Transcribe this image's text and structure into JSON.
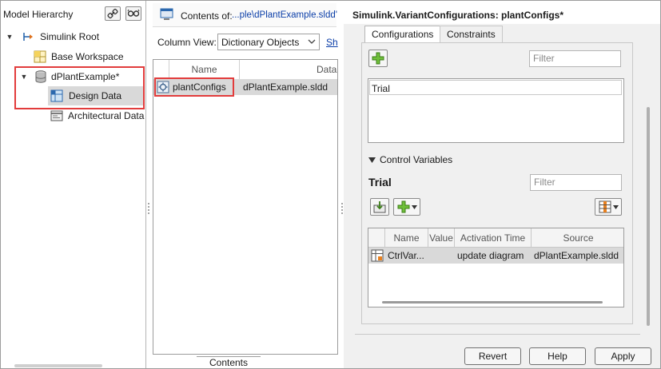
{
  "left_pane": {
    "title": "Model Hierarchy",
    "tree": [
      {
        "label": "Simulink Root",
        "expanded": true
      },
      {
        "label": "Base Workspace"
      },
      {
        "label": "dPlantExample*",
        "expanded": true
      },
      {
        "label": "Design Data",
        "selected": true
      },
      {
        "label": "Architectural Data"
      }
    ]
  },
  "middle_pane": {
    "contents_prefix": "Contents of:",
    "contents_path": "...ple\\dPlantExample.sldd'",
    "column_view_label": "Column View:",
    "column_view_value": "Dictionary Objects",
    "show_link": "Sh",
    "columns": [
      "Name",
      "DataSource"
    ],
    "rows": [
      {
        "name": "plantConfigs",
        "source": "dPlantExample.sldd"
      }
    ],
    "bottom_tab": "Contents"
  },
  "right_pane": {
    "title": "Simulink.VariantConfigurations: plantConfigs*",
    "tabs": [
      "Configurations",
      "Constraints"
    ],
    "filter_placeholder": "Filter",
    "configurations": [
      "Trial"
    ],
    "control_variables_label": "Control Variables",
    "selected_config": "Trial",
    "ctrl_columns": [
      "Name",
      "Value",
      "Activation Time",
      "Source"
    ],
    "ctrl_rows": [
      {
        "name": "CtrlVar...",
        "value": "",
        "activation": "update diagram",
        "source": "dPlantExample.sldd"
      }
    ],
    "buttons": {
      "revert": "Revert",
      "help": "Help",
      "apply": "Apply"
    }
  },
  "colors": {
    "highlight": "#e23c3c",
    "selection": "#d9d9d9",
    "link": "#0b3ea8"
  }
}
